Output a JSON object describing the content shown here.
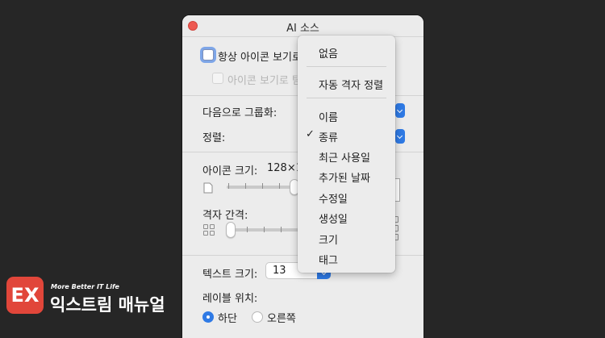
{
  "window": {
    "title": "AI 소스",
    "always_icon_view": "항상 아이콘 보기로",
    "browse_icon_view": "아이콘 보기로 탐",
    "group_by_label": "다음으로 그룹화:",
    "sort_label": "정렬:",
    "icon_size_label": "아이콘 크기:",
    "icon_size_value": "128×1",
    "grid_spacing_label": "격자 간격:",
    "text_size_label": "텍스트 크기:",
    "text_size_value": "13",
    "label_position_label": "레이블 위치:",
    "label_position_options": [
      "하단",
      "오른쪽"
    ],
    "label_position_selected": "하단"
  },
  "menu": {
    "group1": [
      "없음"
    ],
    "group2": [
      "자동 격자 정렬"
    ],
    "group3": [
      "이름",
      "종류",
      "최근 사용일",
      "추가된 날짜",
      "수정일",
      "생성일",
      "크기",
      "태그"
    ],
    "checked_item": "종류"
  },
  "watermark": {
    "badge": "EX",
    "tagline": "More Better IT Life",
    "name": "익스트림 매뉴얼"
  },
  "colors": {
    "accent": "#2f7ae5",
    "close_button": "#ee5a52",
    "logo": "#e1463a",
    "background": "#262626"
  }
}
